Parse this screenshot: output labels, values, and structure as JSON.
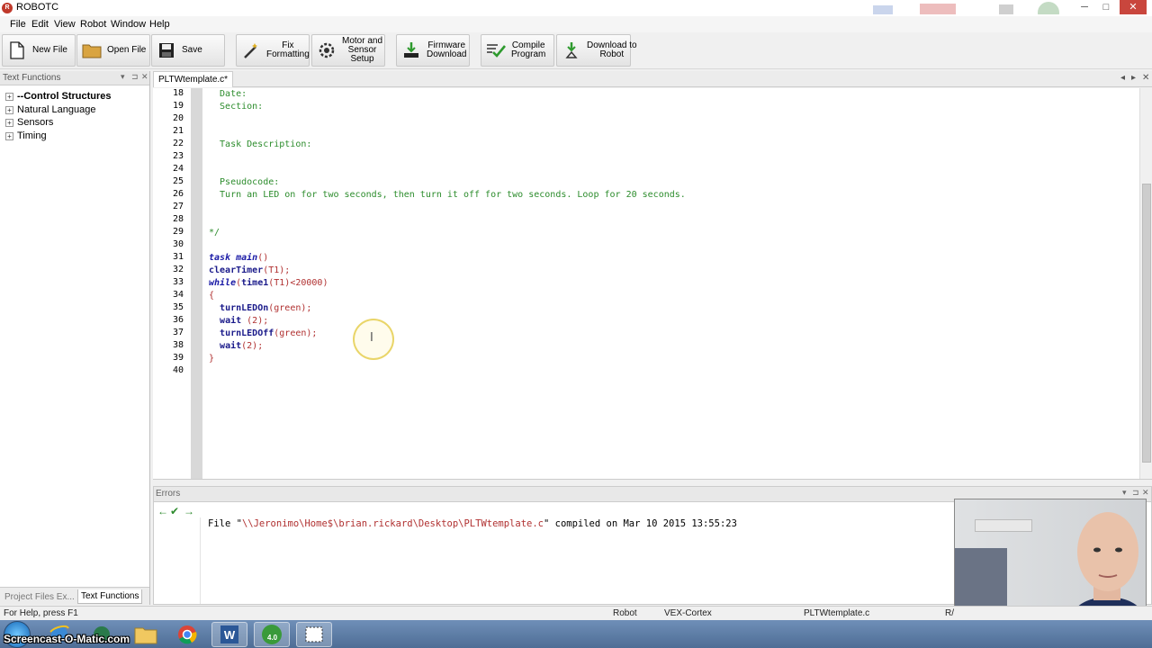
{
  "window": {
    "title": "ROBOTC",
    "minimize_glyph": "─",
    "maximize_glyph": "□",
    "close_glyph": "✕"
  },
  "menu": [
    "File",
    "Edit",
    "View",
    "Robot",
    "Window",
    "Help"
  ],
  "toolbar": {
    "new_file": "New File",
    "open_file": "Open File",
    "save": "Save",
    "fix_formatting": "Fix\nFormatting",
    "motor_sensor_setup": "Motor and\nSensor\nSetup",
    "firmware_download": "Firmware\nDownload",
    "compile_program": "Compile\nProgram",
    "download_to_robot": "Download to\nRobot"
  },
  "left_panel": {
    "title": "Text Functions",
    "items": [
      {
        "label": "--Control Structures",
        "bold": true
      },
      {
        "label": "Natural Language",
        "bold": false
      },
      {
        "label": "Sensors",
        "bold": false
      },
      {
        "label": "Timing",
        "bold": false
      }
    ],
    "expand_glyph": "+",
    "tabs": [
      "Project Files Ex...",
      "Text Functions"
    ],
    "controls": [
      "▾",
      "⊐",
      "✕"
    ]
  },
  "editor": {
    "tab_label": "PLTWtemplate.c*",
    "tab_controls": [
      "◂",
      "▸",
      "✕"
    ],
    "line_numbers": [
      "18",
      "19",
      "20",
      "21",
      "22",
      "23",
      "24",
      "25",
      "26",
      "27",
      "28",
      "29",
      "30",
      "31",
      "32",
      "33",
      "34",
      "35",
      "36",
      "37",
      "38",
      "39",
      "40"
    ],
    "lines": {
      "l18": "  Date:",
      "l19": "  Section:",
      "l22": "  Task Description:",
      "l25": "  Pseudocode:",
      "l26": "  Turn an LED on for two seconds, then turn it off for two seconds. Loop for 20 seconds.",
      "l29": "*/",
      "l31_kw": "task",
      "l31_name": "main",
      "l31_rest": "()",
      "l32_fn": "clearTimer",
      "l32_rest": "(T1);",
      "l33_kw": "while",
      "l33_p1": "(",
      "l33_fn": "time1",
      "l33_rest": "(T1)<20000)",
      "l34": "{",
      "l35_fn": "turnLEDOn",
      "l35_rest": "(green);",
      "l36_fn": "wait",
      "l36_rest": " (2);",
      "l37_fn": "turnLEDOff",
      "l37_rest": "(green);",
      "l38_fn": "wait",
      "l38_rest": "(2);",
      "l39": "}"
    }
  },
  "errors": {
    "title": "Errors",
    "controls": [
      "▾",
      "⊐",
      "✕"
    ],
    "msg_prefix": "File \"",
    "msg_path": "\\\\Jeronimo\\Home$\\brian.rickard\\Desktop\\PLTWtemplate.c",
    "msg_suffix": "\" compiled on Mar 10 2015 13:55:23"
  },
  "statusbar": {
    "help": "For Help, press F1",
    "robot": "Robot",
    "platform": "VEX-Cortex",
    "file": "PLTWtemplate.c",
    "rw": "R/"
  },
  "taskbar": {
    "watermark": "Screencast-O-Matic.com",
    "badge": "4.0"
  },
  "colors": {
    "comment": "#2c8c2c",
    "keyword": "#1a1aa6",
    "number_paren": "#b03030",
    "close_button": "#c9463d"
  }
}
